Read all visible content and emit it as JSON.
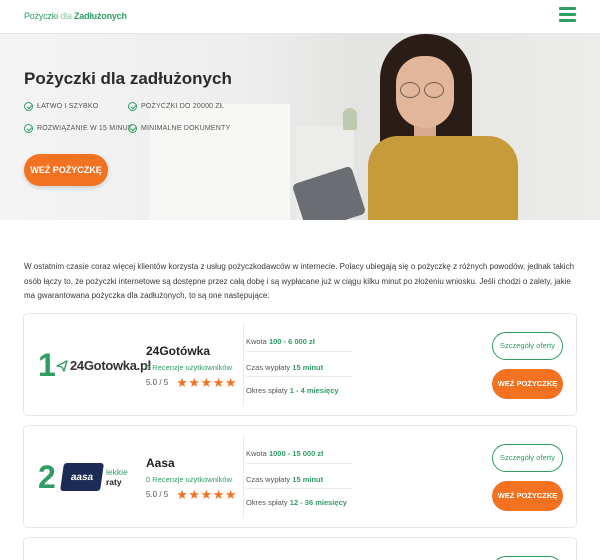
{
  "header": {
    "logo": {
      "part1": "Pożyczki",
      "part2": "dla",
      "part3": "Zadłużonych"
    }
  },
  "hero": {
    "title": "Pożyczki dla zadłużonych",
    "features": [
      "ŁATWO I SZYBKO",
      "POŻYCZKI DO 20000 ZŁ",
      "ROZWIĄZANIE W 15 MINUT",
      "MINIMALNE DOKUMENTY"
    ],
    "cta_label": "WEŹ POŻYCZKĘ"
  },
  "intro": {
    "text": "W ostatnim czasie coraz więcej klientów korzysta z usług pożyczkodawców w internecie. Polacy ubiegają się o pożyczkę z różnych powodów, jednak takich osób łączy to, że pożyczki internetowe są dostępne przez całą dobę i są wypłacane już w ciągu kilku minut po złożeniu wniosku. Jeśli chodzi o zalety, jakie ma gwarantowana pożyczka dla zadłużonych, to są one następujące:"
  },
  "offers": [
    {
      "rank": "1",
      "logo": {
        "text": "24Gotowka.pl"
      },
      "name": "24Gotówka",
      "reviews": "0 Recenzje użytkowników",
      "rating": "5.0 / 5",
      "stars": "★★★★★",
      "amount_label": "Kwota",
      "amount_value": "100 - 6 000 zł",
      "payout_label": "Czas wypłaty",
      "payout_value": "15 minut",
      "term_label": "Okres spłaty",
      "term_value": "1 - 4 miesięcy",
      "details_label": "Szczegóły oferty",
      "cta_label": "WEŹ POŻYCZKĘ"
    },
    {
      "rank": "2",
      "logo": {
        "box": "aasa",
        "line1": "lekkie",
        "line2": "raty"
      },
      "name": "Aasa",
      "reviews": "0 Recenzje użytkowników",
      "rating": "5.0 / 5",
      "stars": "★★★★★",
      "amount_label": "Kwota",
      "amount_value": "1000 - 15 000 zł",
      "payout_label": "Czas wypłaty",
      "payout_value": "15 minut",
      "term_label": "Okres spłaty",
      "term_value": "12 - 36 miesięcy",
      "details_label": "Szczegóły oferty",
      "cta_label": "WEŹ POŻYCZKĘ"
    }
  ],
  "colors": {
    "brand_green": "#2e9e63",
    "accent_orange": "#f27221",
    "star_orange": "#f27221"
  },
  "icons": {
    "menu": "hamburger-icon",
    "feature_check": "check-circle-icon",
    "rating_star": "star-icon",
    "logo_send": "send-arrow-icon"
  }
}
